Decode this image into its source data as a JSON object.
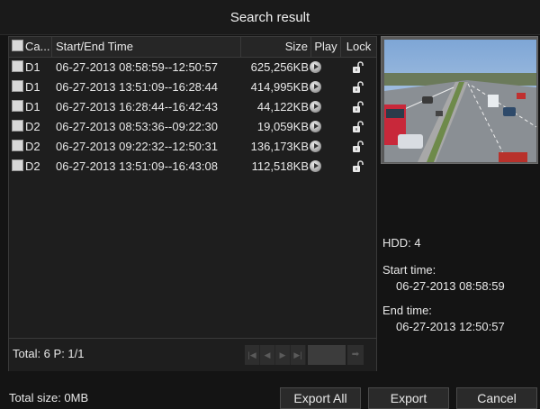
{
  "title": "Search result",
  "table": {
    "headers": {
      "camera": "Ca...",
      "time": "Start/End Time",
      "size": "Size",
      "play": "Play",
      "lock": "Lock"
    },
    "rows": [
      {
        "camera": "D1",
        "time": "06-27-2013 08:58:59--12:50:57",
        "size": "625,256KB"
      },
      {
        "camera": "D1",
        "time": "06-27-2013 13:51:09--16:28:44",
        "size": "414,995KB"
      },
      {
        "camera": "D1",
        "time": "06-27-2013 16:28:44--16:42:43",
        "size": "44,122KB"
      },
      {
        "camera": "D2",
        "time": "06-27-2013 08:53:36--09:22:30",
        "size": "19,059KB"
      },
      {
        "camera": "D2",
        "time": "06-27-2013 09:22:32--12:50:31",
        "size": "136,173KB"
      },
      {
        "camera": "D2",
        "time": "06-27-2013 13:51:09--16:43:08",
        "size": "112,518KB"
      }
    ],
    "play_icon": "play-circle-icon",
    "lock_icon": "unlocked-padlock-icon"
  },
  "pagination": {
    "total": "Total: 6  P: 1/1",
    "first_icon": "first-page-icon",
    "prev_icon": "prev-page-icon",
    "next_icon": "next-page-icon",
    "last_icon": "last-page-icon",
    "go_icon": "go-arrow-icon"
  },
  "details": {
    "hdd": "HDD: 4",
    "start_label": "Start time:",
    "start_value": "06-27-2013 08:58:59",
    "end_label": "End time:",
    "end_value": "06-27-2013 12:50:57"
  },
  "footer": {
    "total_size": "Total size: 0MB",
    "export_all": "Export All",
    "export": "Export",
    "cancel": "Cancel"
  },
  "colors": {
    "background": "#141414",
    "panel": "#1e1e1e",
    "text": "#e8e8e8",
    "border": "#3a3a3a"
  }
}
